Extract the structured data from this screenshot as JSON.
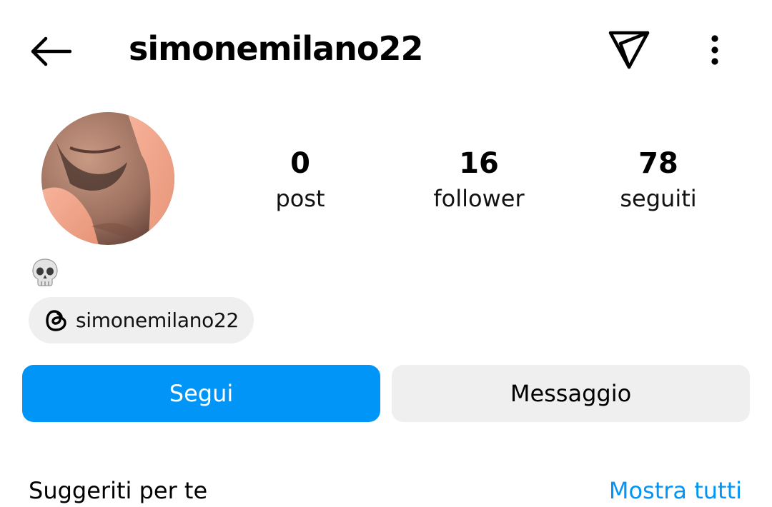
{
  "header": {
    "username": "simonemilano22",
    "back_icon": "arrow-left-icon",
    "send_icon": "paper-plane-icon",
    "more_icon": "more-vertical-icon"
  },
  "profile": {
    "bio_emoji": "skull-emoji",
    "stats": [
      {
        "value": "0",
        "label": "post"
      },
      {
        "value": "16",
        "label": "follower"
      },
      {
        "value": "78",
        "label": "seguiti"
      }
    ],
    "threads_chip": {
      "icon": "threads-icon",
      "label": "simonemilano22"
    }
  },
  "actions": {
    "follow_label": "Segui",
    "message_label": "Messaggio"
  },
  "suggested": {
    "title": "Suggeriti per te",
    "show_all": "Mostra tutti"
  },
  "colors": {
    "accent": "#0095f6",
    "chip_bg": "#efefef"
  }
}
